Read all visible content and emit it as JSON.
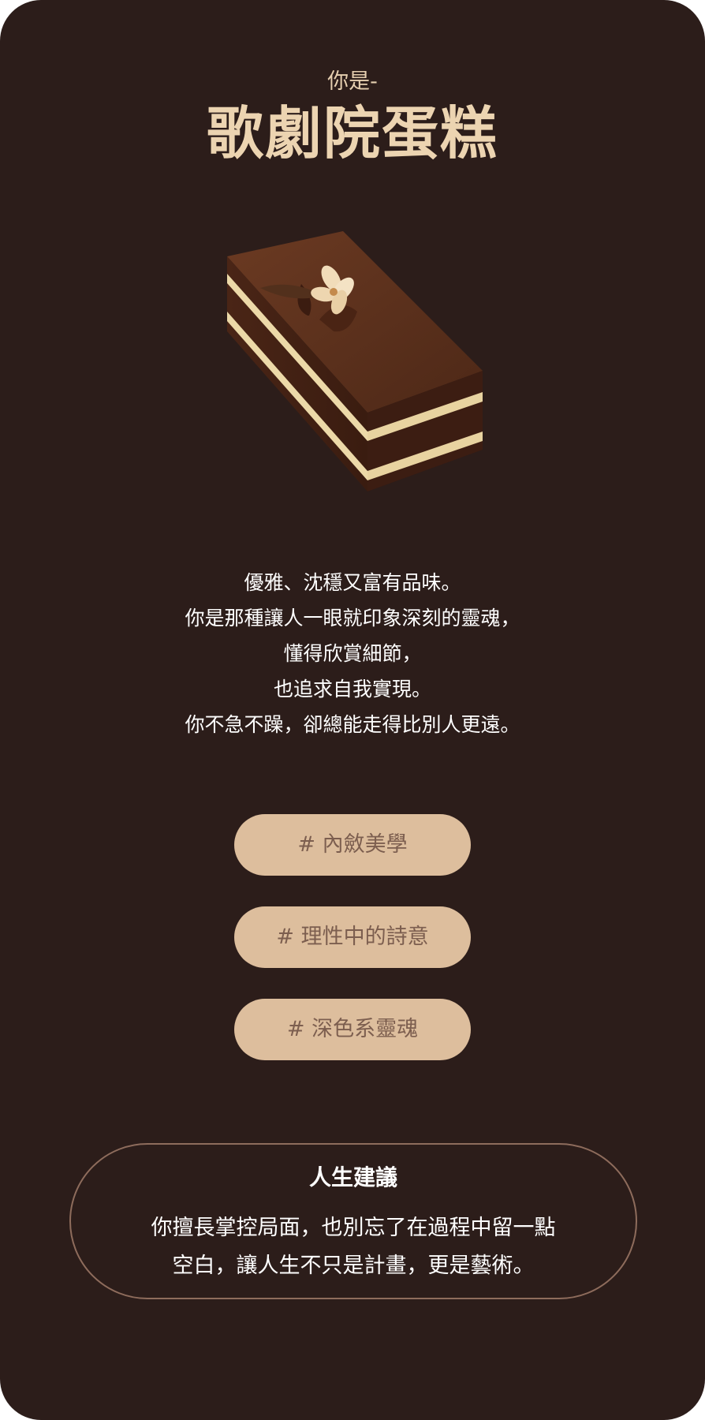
{
  "header": {
    "subtitle": "你是-",
    "title": "歌劇院蛋糕"
  },
  "image": {
    "icon": "opera-cake-illustration"
  },
  "description": {
    "lines": [
      "優雅、沈穩又富有品味。",
      "你是那種讓人一眼就印象深刻的靈魂，",
      "懂得欣賞細節，",
      "也追求自我實現。",
      "你不急不躁，卻總能走得比別人更遠。"
    ]
  },
  "tags": [
    "# 內斂美學",
    "# 理性中的詩意",
    "# 深色系靈魂"
  ],
  "advice": {
    "title": "人生建議",
    "lines": [
      "你擅長掌控局面，也別忘了在過程中留一點",
      "空白，讓人生不只是計畫，更是藝術。"
    ]
  },
  "colors": {
    "background": "#2c1d1a",
    "title": "#ecd4b1",
    "tag_background": "#ddbe9d",
    "tag_text": "#7c5e4f",
    "advice_border": "#8e6c5c"
  }
}
